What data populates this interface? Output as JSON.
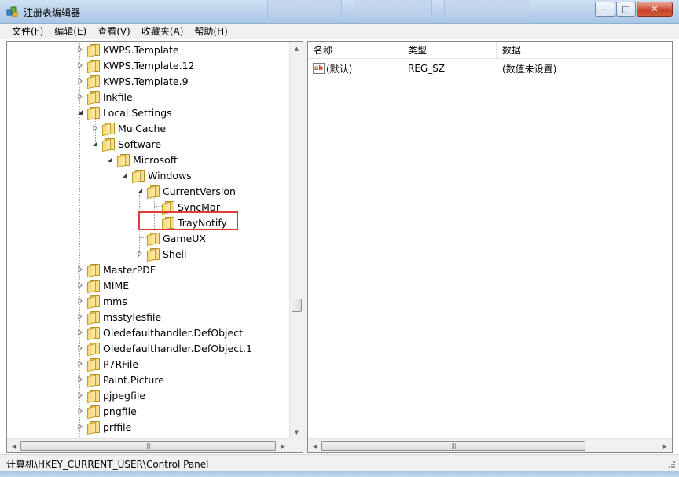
{
  "window": {
    "title": "注册表编辑器",
    "minimize_glyph": "—",
    "maximize_glyph": "□",
    "close_glyph": "✕"
  },
  "menu": [
    "文件(F)",
    "编辑(E)",
    "查看(V)",
    "收藏夹(A)",
    "帮助(H)"
  ],
  "tree": {
    "items": [
      {
        "label": "KWPS.Template",
        "expander": "collapsed"
      },
      {
        "label": "KWPS.Template.12",
        "expander": "collapsed"
      },
      {
        "label": "KWPS.Template.9",
        "expander": "collapsed"
      },
      {
        "label": "lnkfile",
        "expander": "collapsed"
      },
      {
        "label": "Local Settings",
        "expander": "expanded"
      },
      {
        "label": "MuiCache",
        "expander": "collapsed"
      },
      {
        "label": "Software",
        "expander": "expanded"
      },
      {
        "label": "Microsoft",
        "expander": "expanded"
      },
      {
        "label": "Windows",
        "expander": "expanded"
      },
      {
        "label": "CurrentVersion",
        "expander": "expanded"
      },
      {
        "label": "SyncMgr",
        "expander": "none"
      },
      {
        "label": "TrayNotify",
        "expander": "none",
        "highlighted": true
      },
      {
        "label": "GameUX",
        "expander": "none"
      },
      {
        "label": "Shell",
        "expander": "collapsed"
      },
      {
        "label": "MasterPDF",
        "expander": "collapsed"
      },
      {
        "label": "MIME",
        "expander": "collapsed"
      },
      {
        "label": "mms",
        "expander": "collapsed"
      },
      {
        "label": "msstylesfile",
        "expander": "collapsed"
      },
      {
        "label": "Oledefaulthandler.DefObject",
        "expander": "collapsed"
      },
      {
        "label": "Oledefaulthandler.DefObject.1",
        "expander": "collapsed"
      },
      {
        "label": "P7RFile",
        "expander": "collapsed"
      },
      {
        "label": "Paint.Picture",
        "expander": "collapsed"
      },
      {
        "label": "pjpegfile",
        "expander": "collapsed"
      },
      {
        "label": "pngfile",
        "expander": "collapsed"
      },
      {
        "label": "prffile",
        "expander": "collapsed"
      }
    ],
    "highlight_color": "#e03a3a"
  },
  "list": {
    "columns": [
      "名称",
      "类型",
      "数据"
    ],
    "rows": [
      {
        "name": "(默认)",
        "type": "REG_SZ",
        "data": "(数值未设置)",
        "icon": "ab-string-icon"
      }
    ],
    "ab_glyph": "ab"
  },
  "status": {
    "path": "计算机\\HKEY_CURRENT_USER\\Control Panel"
  },
  "scroll_glyphs": {
    "up": "▲",
    "down": "▼",
    "left": "◀",
    "right": "▶",
    "grip": "|||"
  }
}
